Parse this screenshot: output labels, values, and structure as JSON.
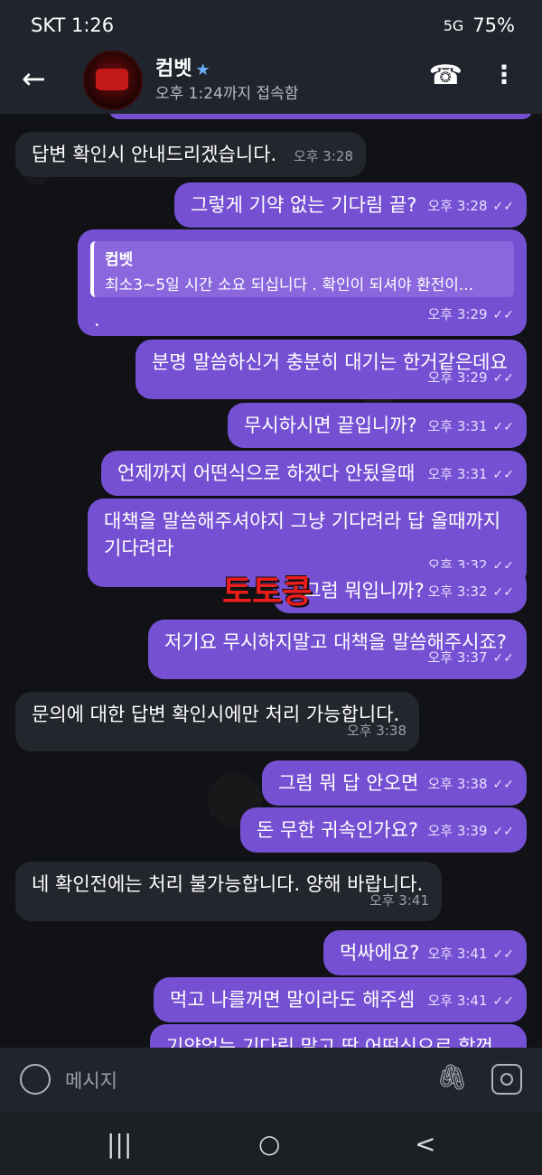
{
  "status": {
    "time_carrier": "SKT 1:26",
    "icons": "💬 ◡ ▣ ●",
    "battery": "75%",
    "network": "5G"
  },
  "header": {
    "name": "컴벳",
    "last_seen": "오후 1:24까지 접속함"
  },
  "messages": [
    {
      "text": "답변 확인시 안내드리겠습니다.",
      "time": "오후 3:28"
    },
    {
      "text": "그렇게 기약 없는 기다림 끝?",
      "time": "오후 3:28"
    },
    {
      "reply_name": "컴벳",
      "reply_text": "최소3~5일 시간 소요 되십니다 . 확인이 되셔야 환전이...",
      "text": ".",
      "time": "오후 3:29"
    },
    {
      "text": "분명 말씀하신거 충분히 대기는 한거같은데요",
      "time": "오후 3:29"
    },
    {
      "text": "무시하시면 끝입니까?",
      "time": "오후 3:31"
    },
    {
      "text": "언제까지 어떤식으로 하겠다 안됬을때",
      "time": "오후 3:31"
    },
    {
      "text": "대책을 말씀해주셔야지 그냥 기다려라 답 올때까지 기다려라",
      "time": "오후 3:32"
    },
    {
      "text": "그럼 뭐입니까?",
      "time": "오후 3:32"
    },
    {
      "text": "저기요 무시하지말고 대책을 말씀해주시죠?",
      "time": "오후 3:37"
    },
    {
      "text": "문의에 대한 답변 확인시에만 처리 가능합니다.",
      "time": "오후 3:38"
    },
    {
      "text": "그럼 뭐 답 안오면",
      "time": "오후 3:38"
    },
    {
      "text": "돈 무한 귀속인가요?",
      "time": "오후 3:39"
    },
    {
      "text": "네 확인전에는 처리 불가능합니다. 양해 바랍니다.",
      "time": "오후 3:41"
    },
    {
      "text": "먹싸에요?",
      "time": "오후 3:41"
    },
    {
      "text": "먹고 나를꺼면 말이라도 해주셈",
      "time": "오후 3:41"
    },
    {
      "text": "기약없는 기다림 말고 딱 어떤식으로 할껀지",
      "time": ""
    }
  ],
  "watermark": "토토콩",
  "input": {
    "placeholder": "메시지"
  },
  "nav": {
    "recent": "|||",
    "home": "○",
    "back": "<"
  }
}
